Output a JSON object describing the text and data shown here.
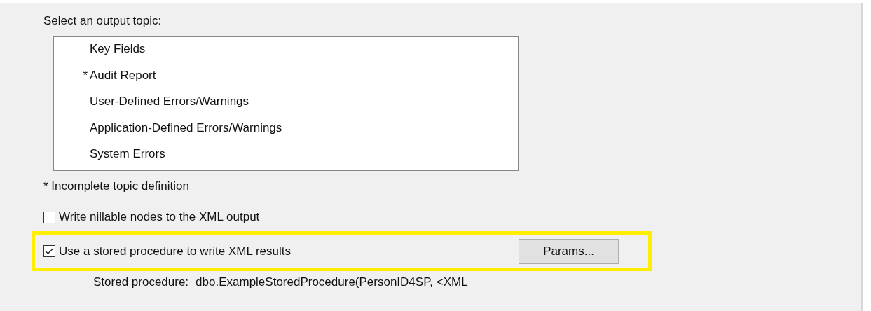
{
  "topic_list": {
    "label": "Select an output topic:",
    "items": [
      {
        "text": "Key Fields",
        "incomplete": false
      },
      {
        "text": "Audit Report",
        "incomplete": true
      },
      {
        "text": "User-Defined Errors/Warnings",
        "incomplete": false
      },
      {
        "text": "Application-Defined Errors/Warnings",
        "incomplete": false
      },
      {
        "text": "System Errors",
        "incomplete": false
      }
    ],
    "marker": "*",
    "note": "* Incomplete topic definition"
  },
  "options": [
    {
      "label": "Write nillable nodes to the XML output",
      "checked": false,
      "highlighted": false
    },
    {
      "label": "Use a stored procedure to write XML results",
      "checked": true,
      "highlighted": true,
      "button": "Params..."
    }
  ],
  "stored_procedure": {
    "label": "Stored procedure:",
    "value": "dbo.ExampleStoredProcedure(PersonID4SP, <XML"
  }
}
